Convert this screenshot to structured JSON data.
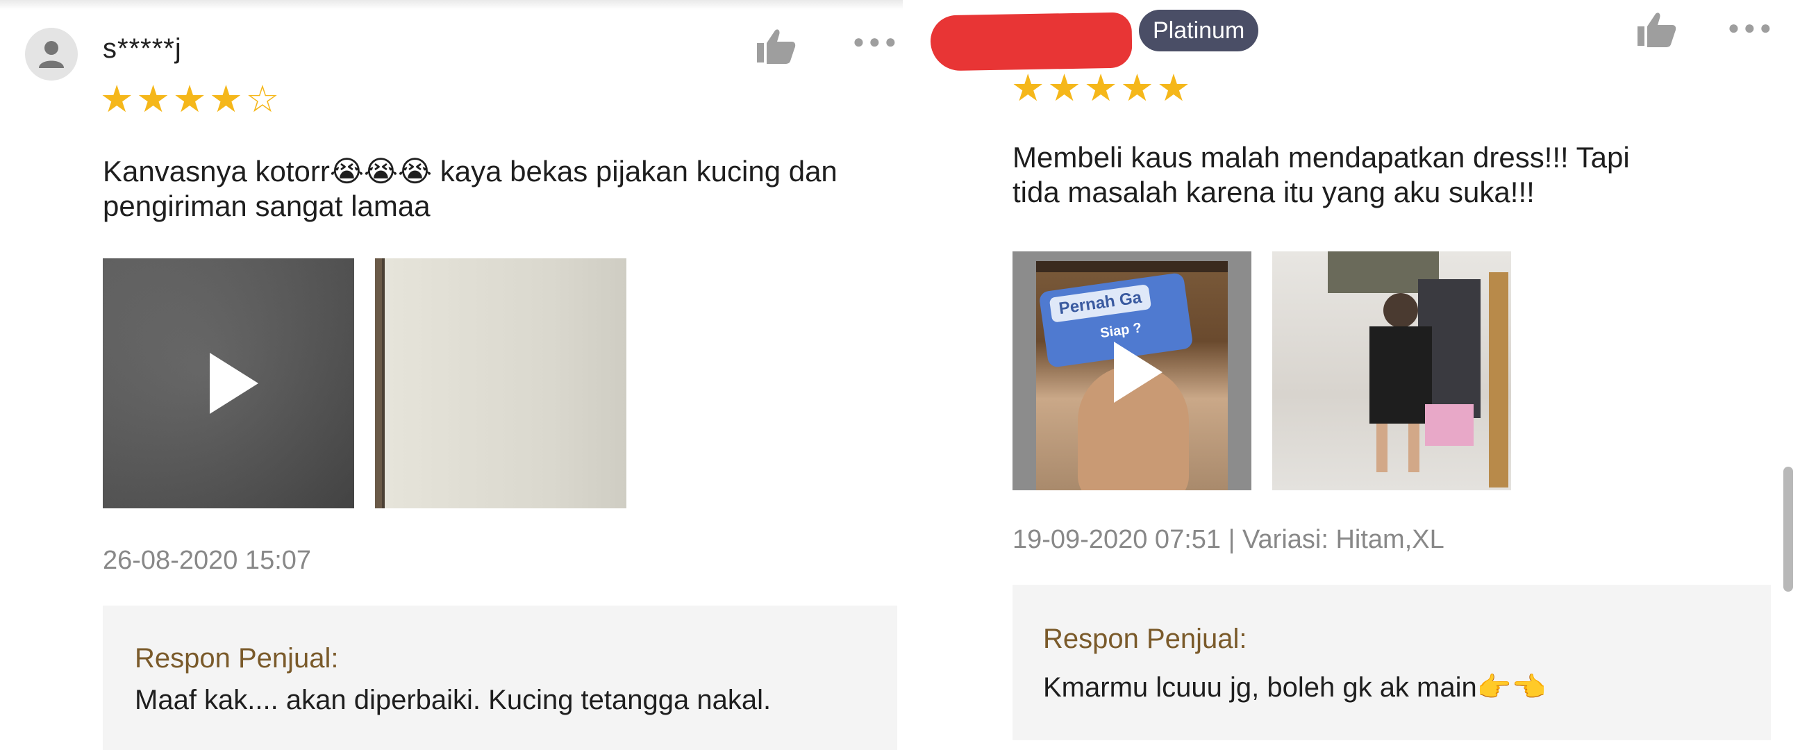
{
  "left_review": {
    "username": "s*****j",
    "rating": 4,
    "text_line1_a": "Kanvasnya kotorr",
    "emojis": "😭😭😭",
    "text_line1_b": " kaya bekas pijakan kucing dan",
    "text_line2": "pengiriman sangat lamaa",
    "timestamp": "26-08-2020 15:07",
    "seller_reply_label": "Respon Penjual:",
    "seller_reply_text": "Maaf kak.... akan diperbaiki. Kucing tetangga nakal."
  },
  "right_review": {
    "tier_badge": "Platinum",
    "rating": 5,
    "text_line1": "Membeli kaus malah mendapatkan dress!!! Tapi",
    "text_line2": "tida masalah karena itu yang aku suka!!!",
    "video_caption_top": "Pernah Ga",
    "video_caption_sub": "Siap ?",
    "timestamp_variation": "19-09-2020 07:51 | Variasi: Hitam,XL",
    "seller_reply_label": "Respon Penjual:",
    "seller_reply_text": "Kmarmu lcuuu jg, boleh gk ak main",
    "seller_reply_emojis": "👉👈"
  },
  "icons": {
    "avatar": "user-avatar-icon",
    "like": "thumbs-up-icon",
    "more": "more-dots-icon",
    "play": "play-icon",
    "star": "star-icon"
  },
  "colors": {
    "star": "#f5b71a",
    "reply_label": "#7a5a2a",
    "badge_bg": "#4a4e66",
    "redaction": "#e83535"
  }
}
